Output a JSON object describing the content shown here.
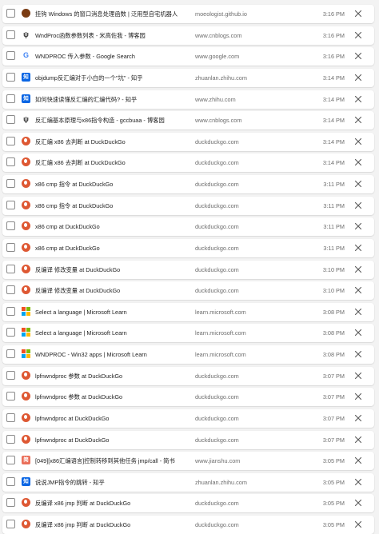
{
  "rows": [
    {
      "icon": "moe-icon",
      "title": "挂钩 Windows 的窗口消息处理函数 | 泛用型自宅机器人",
      "domain": "moeologist.github.io",
      "time": "3:16 PM"
    },
    {
      "icon": "cnblogs-icon",
      "title": "WndProc函数参数列表 - 米高佐我 - 博客园",
      "domain": "www.cnblogs.com",
      "time": "3:16 PM"
    },
    {
      "icon": "google-icon",
      "title": "WNDPROC 传入参数 - Google Search",
      "domain": "www.google.com",
      "time": "3:16 PM"
    },
    {
      "icon": "zhihu-icon",
      "title": "objdump反汇编对于小白的一个\"坑\" - 知乎",
      "domain": "zhuanlan.zhihu.com",
      "time": "3:14 PM"
    },
    {
      "icon": "zhihu-icon",
      "title": "如何快速读懂反汇编的汇编代码? - 知乎",
      "domain": "www.zhihu.com",
      "time": "3:14 PM"
    },
    {
      "icon": "cnblogs-icon",
      "title": "反汇编基本原理与x86指令构造 - gccbuaa - 博客园",
      "domain": "www.cnblogs.com",
      "time": "3:14 PM"
    },
    {
      "icon": "duckduckgo-icon",
      "title": "反汇编 x86 去判断 at DuckDuckGo",
      "domain": "duckduckgo.com",
      "time": "3:14 PM"
    },
    {
      "icon": "duckduckgo-icon",
      "title": "反汇编 x86 去判断 at DuckDuckGo",
      "domain": "duckduckgo.com",
      "time": "3:14 PM"
    },
    {
      "icon": "duckduckgo-icon",
      "title": "x86 cmp 指令 at DuckDuckGo",
      "domain": "duckduckgo.com",
      "time": "3:11 PM"
    },
    {
      "icon": "duckduckgo-icon",
      "title": "x86 cmp 指令 at DuckDuckGo",
      "domain": "duckduckgo.com",
      "time": "3:11 PM"
    },
    {
      "icon": "duckduckgo-icon",
      "title": "x86 cmp at DuckDuckGo",
      "domain": "duckduckgo.com",
      "time": "3:11 PM"
    },
    {
      "icon": "duckduckgo-icon",
      "title": "x86 cmp at DuckDuckGo",
      "domain": "duckduckgo.com",
      "time": "3:11 PM"
    },
    {
      "icon": "duckduckgo-icon",
      "title": "反编译 修改变量 at DuckDuckGo",
      "domain": "duckduckgo.com",
      "time": "3:10 PM"
    },
    {
      "icon": "duckduckgo-icon",
      "title": "反编译 修改变量 at DuckDuckGo",
      "domain": "duckduckgo.com",
      "time": "3:10 PM"
    },
    {
      "icon": "microsoft-icon",
      "title": "Select a language | Microsoft Learn",
      "domain": "learn.microsoft.com",
      "time": "3:08 PM"
    },
    {
      "icon": "microsoft-icon",
      "title": "Select a language | Microsoft Learn",
      "domain": "learn.microsoft.com",
      "time": "3:08 PM"
    },
    {
      "icon": "microsoft-icon",
      "title": "WNDPROC - Win32 apps | Microsoft Learn",
      "domain": "learn.microsoft.com",
      "time": "3:08 PM"
    },
    {
      "icon": "duckduckgo-icon",
      "title": "lpfnwndproc 参数 at DuckDuckGo",
      "domain": "duckduckgo.com",
      "time": "3:07 PM"
    },
    {
      "icon": "duckduckgo-icon",
      "title": "lpfnwndproc 参数 at DuckDuckGo",
      "domain": "duckduckgo.com",
      "time": "3:07 PM"
    },
    {
      "icon": "duckduckgo-icon",
      "title": "lpfnwndproc at DuckDuckGo",
      "domain": "duckduckgo.com",
      "time": "3:07 PM"
    },
    {
      "icon": "duckduckgo-icon",
      "title": "lpfnwndproc at DuckDuckGo",
      "domain": "duckduckgo.com",
      "time": "3:07 PM"
    },
    {
      "icon": "jianshu-icon",
      "title": "[049][x86汇编语言]控制转移到其他任务 jmp/call - 简书",
      "domain": "www.jianshu.com",
      "time": "3:05 PM"
    },
    {
      "icon": "zhihu-icon",
      "title": "说说JMP指令的跳转 - 知乎",
      "domain": "zhuanlan.zhihu.com",
      "time": "3:05 PM"
    },
    {
      "icon": "duckduckgo-icon",
      "title": "反编译 x86 jmp 判断 at DuckDuckGo",
      "domain": "duckduckgo.com",
      "time": "3:05 PM"
    },
    {
      "icon": "duckduckgo-icon",
      "title": "反编译 x86 jmp 判断 at DuckDuckGo",
      "domain": "duckduckgo.com",
      "time": "3:05 PM"
    }
  ],
  "icon_glyphs": {
    "cnblogs-icon": "ψ",
    "google-icon": "G",
    "zhihu-icon": "知",
    "jianshu-icon": "简"
  },
  "colors": {
    "zhihu": "#0a66e4",
    "duckduckgo": "#de5833",
    "google": "#4285f4",
    "jianshu": "#ea6f5a",
    "ms_red": "#f25022",
    "ms_green": "#7fba00",
    "ms_blue": "#00a4ef",
    "ms_yellow": "#ffb900"
  }
}
